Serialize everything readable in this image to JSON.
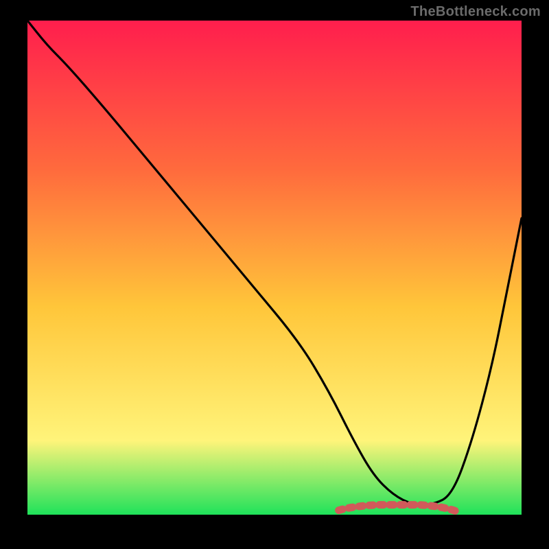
{
  "watermark": "TheBottleneck.com",
  "colors": {
    "gradient_top": "#ff1e4d",
    "gradient_mid1": "#ff6a3d",
    "gradient_mid2": "#ffc63a",
    "gradient_mid3": "#fff47a",
    "gradient_bottom": "#1fe25a",
    "curve": "#000000",
    "accent": "#d15a5a",
    "background": "#000000"
  },
  "chart_data": {
    "type": "line",
    "title": "",
    "xlabel": "",
    "ylabel": "",
    "xlim": [
      0,
      100
    ],
    "ylim": [
      0,
      100
    ],
    "series": [
      {
        "name": "bottleneck-curve",
        "x": [
          0,
          4,
          8,
          15,
          25,
          35,
          45,
          55,
          61,
          66,
          70,
          74,
          78,
          82,
          86,
          90,
          94,
          97,
          100
        ],
        "y": [
          100,
          95,
          91,
          83,
          71,
          59,
          47,
          35,
          25,
          15,
          8,
          4,
          2,
          2,
          4,
          15,
          30,
          45,
          60
        ]
      }
    ],
    "accent_region": {
      "name": "low-bottleneck-band",
      "x_start": 63,
      "x_end": 87,
      "y": 2
    }
  }
}
